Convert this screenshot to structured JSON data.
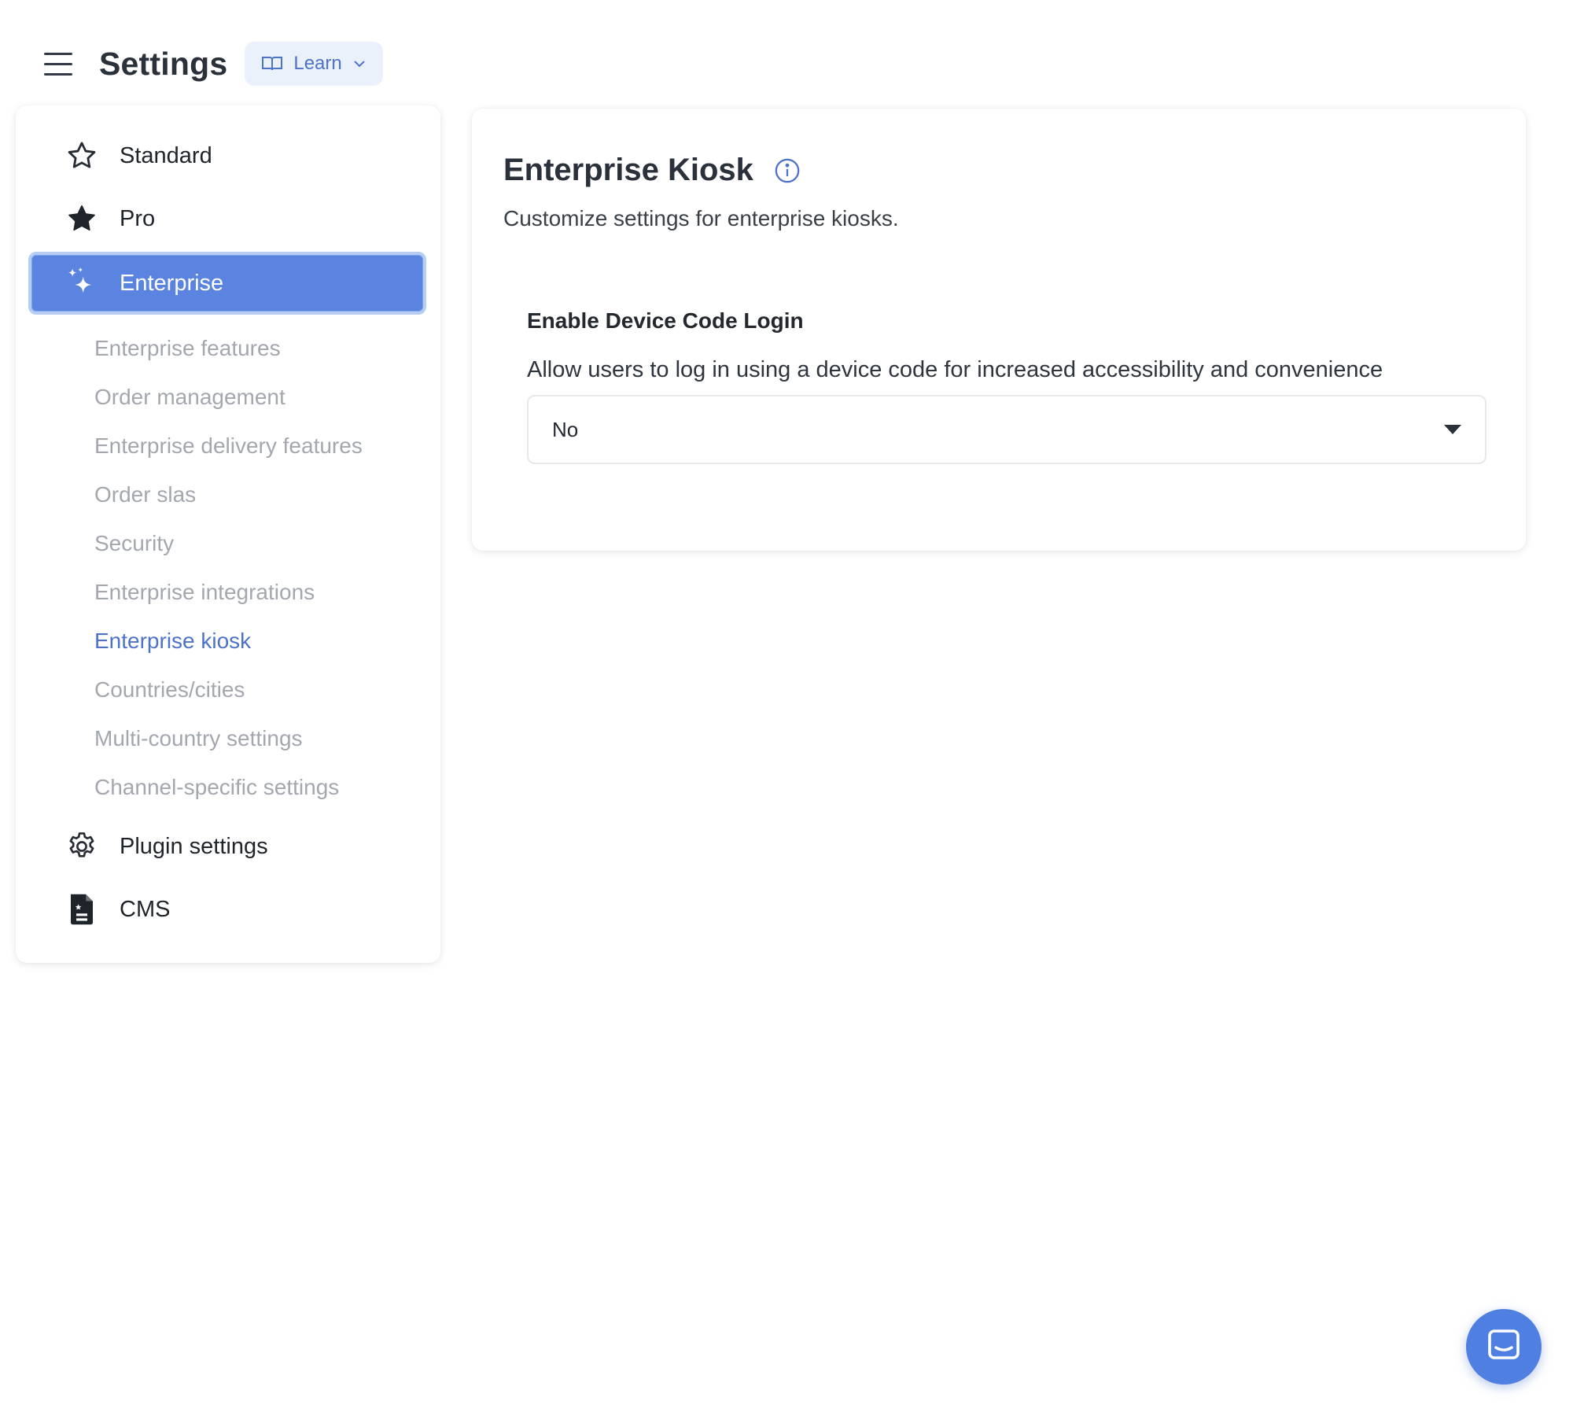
{
  "header": {
    "title": "Settings",
    "learn_label": "Learn",
    "menu_icon": "hamburger-icon",
    "learn_icon": "book-icon",
    "learn_chevron": "chevron-down-icon"
  },
  "sidebar": {
    "items": [
      {
        "label": "Standard",
        "icon": "star-outline-icon"
      },
      {
        "label": "Pro",
        "icon": "star-filled-icon"
      },
      {
        "label": "Enterprise",
        "icon": "sparkles-icon",
        "active": true
      },
      {
        "label": "Plugin settings",
        "icon": "gear-icon"
      },
      {
        "label": "CMS",
        "icon": "document-icon"
      }
    ],
    "sub_items": [
      "Enterprise features",
      "Order management",
      "Enterprise delivery features",
      "Order slas",
      "Security",
      "Enterprise integrations",
      "Enterprise kiosk",
      "Countries/cities",
      "Multi-country settings",
      "Channel-specific settings"
    ],
    "current_sub_item": "Enterprise kiosk"
  },
  "main": {
    "title": "Enterprise Kiosk",
    "subtitle": "Customize settings for enterprise kiosks.",
    "field": {
      "label": "Enable Device Code Login",
      "description": "Allow users to log in using a device code for increased accessibility and convenience",
      "value": "No"
    }
  },
  "colors": {
    "accent": "#5a84df",
    "link": "#4d72c9",
    "muted_text": "#a3a7ae",
    "chat_button": "#4f7fe0"
  }
}
